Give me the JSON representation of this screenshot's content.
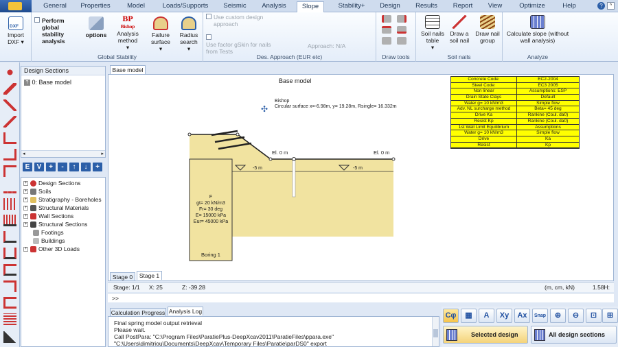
{
  "tabs": [
    "General",
    "Properties",
    "Model",
    "Loads/Supports",
    "Seismic",
    "Analysis",
    "Slope",
    "Stability+",
    "Design",
    "Results",
    "Report",
    "View",
    "Optimize",
    "Help"
  ],
  "ribbon": {
    "import_label": "Import",
    "import_sub": "DXF",
    "global_check": "Perform global stability analysis",
    "options_label": "options",
    "analysis_method": "Analysis method",
    "failure_surface": "Failure surface",
    "radius_search": "Radius search",
    "bp_icon_text": "BP",
    "bishop_icon_text": "Bishop",
    "group_global": "Global Stability",
    "custom_design": "Use custom design approach",
    "factor_gskin": "Use factor gSkin for nails from Tests",
    "approach": "Approach: N/A",
    "group_des": "Des. Approach (EUR etc)",
    "group_draw": "Draw tools",
    "soil_nails_table": "Soil nails table",
    "draw_soil_nail": "Draw a soil nail",
    "draw_nail_group": "Draw nail group",
    "group_soil_nails": "Soil nails",
    "calc_slope": "Calculate slope (without wall analysis)",
    "group_analyze": "Analyze"
  },
  "design_sections": {
    "title": "Design Sections",
    "item": "0: Base model"
  },
  "tree": [
    "Design Sections",
    "Soils",
    "Stratigraphy - Boreholes",
    "Structural Materials",
    "Wall Sections",
    "Structural Sections",
    "Footings",
    "Buildings",
    "Other 3D Loads"
  ],
  "toolbar_buttons": [
    "E",
    "V",
    "+",
    "-",
    "↑",
    "↓",
    "+"
  ],
  "drawing": {
    "tab": "Base model",
    "title": "Base model",
    "bishop_label": "Bishop",
    "circular_surface": "Circular surface x=-6.98m, y= 19.28m, Rsingle= 16.332m",
    "el_left": "El. 0 m",
    "el_right": "El. 0 m",
    "water_left": "-5 m",
    "water_right": "-5 m",
    "soil_name": "F",
    "soil_props": [
      "gt= 20 kN/m3",
      "Fr= 30 deg",
      "E= 15000 kPa",
      "Eur= 45000 kPa"
    ],
    "boring_label": "Boring 1"
  },
  "info_table": [
    [
      "Concrete Code:",
      "EC2-2004"
    ],
    [
      "Steel Code:",
      "EC3 2005"
    ],
    [
      "Non linear",
      "Assumptions: ESP"
    ],
    [
      "Drain State Clays",
      "Default"
    ],
    [
      "Water g= 10 kN/m3",
      "Simple flow"
    ],
    [
      "Adv. NL surcharge method",
      "Beta= 45 deg"
    ],
    [
      "Drive Ka",
      "Rankine (Coul. da0)"
    ],
    [
      "Resist Kp",
      "Rankine (Coul. da0)"
    ],
    [
      "1st Wall Limit Equilibrium",
      "Assumptions"
    ],
    [
      "Water g= 10 kN/m3",
      "Simple flow"
    ],
    [
      "Drive",
      "Ka"
    ],
    [
      "Resist",
      "Kp"
    ]
  ],
  "stage_tabs": [
    "Stage 0",
    "Stage 1"
  ],
  "status": {
    "stage": "Stage: 1/1",
    "x": "X: 25",
    "z": "Z: -39.28",
    "units": "(m, cm, kN)",
    "zoom": "1.58H:"
  },
  "cmd": ">>",
  "log_tabs": [
    "Calculation Progress",
    "Analysis Log"
  ],
  "log_lines": [
    "Final spring model output retrieval",
    "Please wait.",
    "Call PostPara:  \"C:\\Program Files\\ParatiePlus-DeepXcav2011\\ParatieFiles\\ppara.exe\"",
    "\"C:\\Users\\dimitriou\\Documents\\DeepXcav\\Temporary Files\\Paratie\\parDS0\" export"
  ],
  "bottom_buttons": {
    "selected": "Selected design",
    "all": "All design sections"
  },
  "tool_icons": [
    "Cφ",
    "▦",
    "A",
    "Xy",
    "Ax",
    "Snap",
    "zoom-in-icon",
    "zoom-out-icon",
    "zoom-window-icon",
    "zoom-extents-icon"
  ],
  "colors": {
    "soil": "#f1e3a0",
    "table_bg": "#ffff00",
    "accent": "#2c5fa8"
  }
}
